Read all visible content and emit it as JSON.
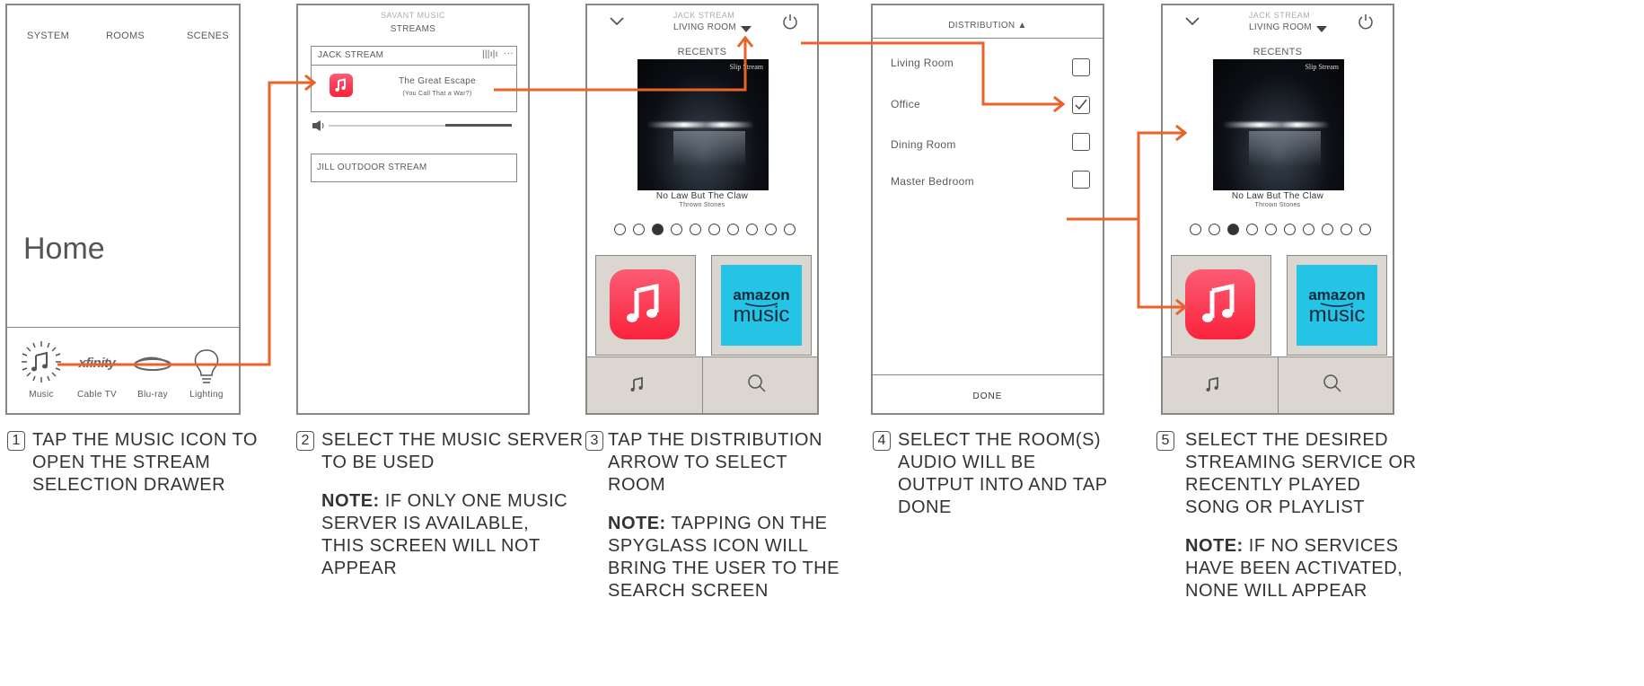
{
  "screen1": {
    "nav": [
      "SYSTEM",
      "ROOMS",
      "SCENES"
    ],
    "title": "Home",
    "icons": [
      {
        "label": "Music",
        "icon": "music-note-icon"
      },
      {
        "label": "Cable TV",
        "icon": "xfinity-logo"
      },
      {
        "label": "Blu-ray",
        "icon": "bluray-logo"
      },
      {
        "label": "Lighting",
        "icon": "lightbulb-icon"
      }
    ],
    "xfinity_text": "xfinity"
  },
  "screen2": {
    "header_top": "SAVANT MUSIC",
    "header": "STREAMS",
    "stream1_name": "JACK STREAM",
    "stream1_bars": "|||ı|ı",
    "stream1_more": "···",
    "track_title": "The Great Escape",
    "track_subtitle": "(You Call That a War?)",
    "stream2_name": "JILL OUTDOOR STREAM"
  },
  "screen3": {
    "stream": "JACK STREAM",
    "room": "LIVING ROOM",
    "section": "RECENTS",
    "album_label": "Slip Stream",
    "song": "No Law But The Claw",
    "artist": "Thrown Stones",
    "pager_total": 10,
    "pager_active": 3,
    "amazon_line1": "amazon",
    "amazon_line2": "music"
  },
  "screen4": {
    "header": "DISTRIBUTION ▲",
    "rooms": [
      {
        "name": "Living Room",
        "checked": false
      },
      {
        "name": "Office",
        "checked": true
      },
      {
        "name": "Dining Room",
        "checked": false
      },
      {
        "name": "Master Bedroom",
        "checked": false
      }
    ],
    "done": "DONE"
  },
  "screen5": {
    "stream": "JACK STREAM",
    "room": "LIVING ROOM",
    "section": "RECENTS",
    "album_label": "Slip Stream",
    "song": "No Law But The Claw",
    "artist": "Thrown Stones",
    "amazon_line1": "amazon",
    "amazon_line2": "music"
  },
  "steps": [
    {
      "num": "1",
      "text_lines": [
        "TAP THE MUSIC ICON TO",
        "OPEN THE STREAM",
        "SELECTION DRAWER"
      ],
      "note_label": "",
      "note_lines": []
    },
    {
      "num": "2",
      "text_lines": [
        "SELECT THE MUSIC SERVER",
        "TO BE USED"
      ],
      "note_label": "NOTE:",
      "note_lines": [
        " IF ONLY ONE MUSIC",
        "SERVER IS AVAILABLE,",
        "THIS SCREEN WILL NOT",
        "APPEAR"
      ]
    },
    {
      "num": "3",
      "text_lines": [
        "TAP THE DISTRIBUTION",
        "ARROW TO SELECT",
        "ROOM"
      ],
      "note_label": "NOTE:",
      "note_lines": [
        " TAPPING ON THE",
        "SPYGLASS ICON WILL",
        "BRING THE USER TO THE",
        "SEARCH SCREEN"
      ]
    },
    {
      "num": "4",
      "text_lines": [
        "SELECT THE ROOM(S)",
        "AUDIO WILL BE",
        "OUTPUT INTO AND TAP",
        "DONE"
      ],
      "note_label": "",
      "note_lines": []
    },
    {
      "num": "5",
      "text_lines": [
        "SELECT THE DESIRED",
        "STREAMING SERVICE OR",
        "RECENTLY PLAYED",
        "SONG OR PLAYLIST"
      ],
      "note_label": "NOTE:",
      "note_lines": [
        " IF NO SERVICES",
        "HAVE BEEN ACTIVATED,",
        "NONE WILL APPEAR"
      ]
    }
  ],
  "colors": {
    "arrow": "#e8622a",
    "frame": "#8a8680",
    "tile": "#dbd6d0",
    "apple_music": "#fa233b",
    "amazon": "#25c4e6"
  }
}
